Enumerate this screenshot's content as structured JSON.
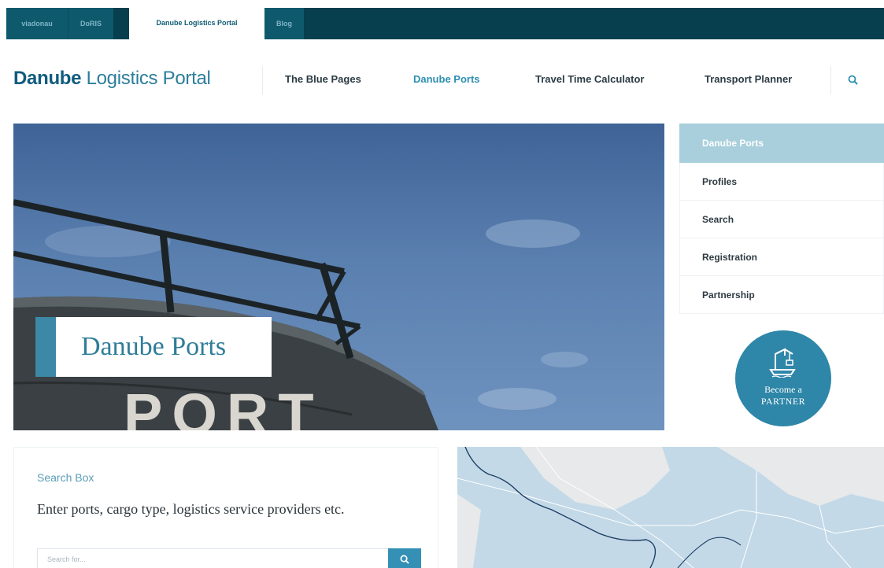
{
  "topbar": {
    "tabs": [
      {
        "label": "viadonau",
        "active": false
      },
      {
        "label": "DoRIS",
        "active": false
      },
      {
        "label": "Danube Logistics Portal",
        "active": true
      },
      {
        "label": "Blog",
        "active": false
      }
    ]
  },
  "header": {
    "logo_bold": "Danube",
    "logo_rest": " Logistics Portal",
    "nav": [
      {
        "label": "The Blue Pages",
        "active": false
      },
      {
        "label": "Danube Ports",
        "active": true
      },
      {
        "label": "Travel Time Calculator",
        "active": false
      },
      {
        "label": "Transport Planner",
        "active": false
      }
    ],
    "search_icon": "search-icon"
  },
  "hero": {
    "title": "Danube Ports",
    "painted_text": "PORT"
  },
  "sidebar": {
    "items": [
      {
        "label": "Danube Ports",
        "active": true
      },
      {
        "label": "Profiles",
        "active": false
      },
      {
        "label": "Search",
        "active": false
      },
      {
        "label": "Registration",
        "active": false
      },
      {
        "label": "Partnership",
        "active": false
      }
    ],
    "partner": {
      "line1": "Become a",
      "line2": "PARTNER",
      "icon": "crane-icon"
    }
  },
  "search_box": {
    "heading": "Search Box",
    "description": "Enter ports, cargo type, logistics service providers etc.",
    "placeholder": "Search for...",
    "button_icon": "search-icon"
  },
  "colors": {
    "topbar": "#073f4f",
    "accent": "#2e86a8",
    "active_sidebar": "#a8cfdb"
  }
}
